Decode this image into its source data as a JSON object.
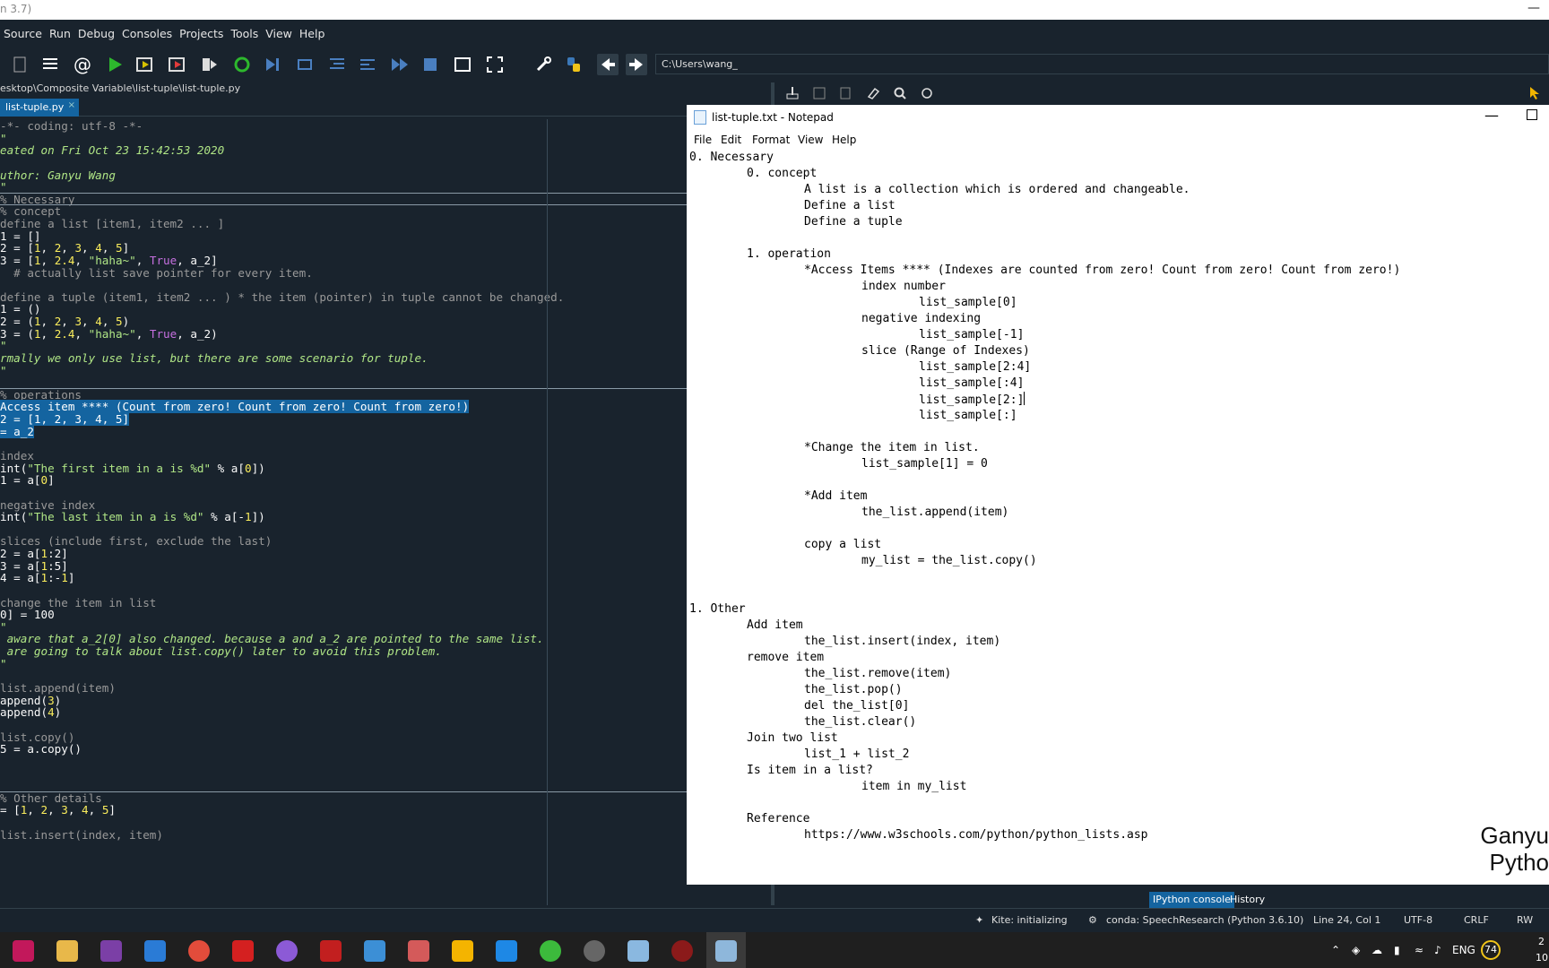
{
  "window": {
    "title_fragment": "n 3.7)"
  },
  "menubar": [
    "Source",
    "Run",
    "Debug",
    "Consoles",
    "Projects",
    "Tools",
    "View",
    "Help"
  ],
  "toolbar": {
    "path": "C:\\Users\\wang_"
  },
  "editor": {
    "file_path": "esktop\\Composite Variable\\list-tuple\\list-tuple.py",
    "tab_label": "list-tuple.py",
    "lines": [
      {
        "t": "-*- coding: utf-8 -*-",
        "c": "com"
      },
      {
        "t": "\"",
        "c": "doc"
      },
      {
        "t": "eated on Fri Oct 23 15:42:53 2020",
        "c": "doc"
      },
      {
        "t": "",
        "c": "doc"
      },
      {
        "t": "uthor: Ganyu Wang",
        "c": "doc"
      },
      {
        "t": "\"",
        "c": "doc"
      },
      {
        "t": "% Necessary",
        "c": "cell"
      },
      {
        "t": "% concept",
        "c": "cell"
      },
      {
        "t": "define a list [item1, item2 ... ]",
        "c": "com"
      },
      {
        "t": "1 = []",
        "c": "code"
      },
      {
        "t": "2 = [1, 2, 3, 4, 5]",
        "c": "code"
      },
      {
        "t": "3 = [1, 2.4, \"haha~\", True, a_2]",
        "c": "code"
      },
      {
        "t": "  # actually list save pointer for every item.",
        "c": "com"
      },
      {
        "t": "",
        "c": "code"
      },
      {
        "t": "define a tuple (item1, item2 ... ) * the item (pointer) in tuple cannot be changed.",
        "c": "com"
      },
      {
        "t": "1 = ()",
        "c": "code"
      },
      {
        "t": "2 = (1, 2, 3, 4, 5)",
        "c": "code"
      },
      {
        "t": "3 = (1, 2.4, \"haha~\", True, a_2)",
        "c": "code"
      },
      {
        "t": "\"",
        "c": "doc"
      },
      {
        "t": "rmally we only use list, but there are some scenario for tuple.",
        "c": "doc"
      },
      {
        "t": "\"",
        "c": "doc"
      },
      {
        "t": "",
        "c": "code"
      },
      {
        "t": "% operations",
        "c": "cell"
      },
      {
        "t": "Access item **** (Count from zero! Count from zero! Count from zero!)",
        "c": "sel"
      },
      {
        "t": "2 = [1, 2, 3, 4, 5]",
        "c": "sel"
      },
      {
        "t": "= a_2",
        "c": "sel"
      },
      {
        "t": "",
        "c": "code"
      },
      {
        "t": "index",
        "c": "com"
      },
      {
        "t": "int(\"The first item in a is %d\" % a[0])",
        "c": "code"
      },
      {
        "t": "1 = a[0]",
        "c": "code"
      },
      {
        "t": "",
        "c": "code"
      },
      {
        "t": "negative index",
        "c": "com"
      },
      {
        "t": "int(\"The last item in a is %d\" % a[-1])",
        "c": "code"
      },
      {
        "t": "",
        "c": "code"
      },
      {
        "t": "slices (include first, exclude the last)",
        "c": "com"
      },
      {
        "t": "2 = a[1:2]",
        "c": "code"
      },
      {
        "t": "3 = a[1:5]",
        "c": "code"
      },
      {
        "t": "4 = a[1:-1]",
        "c": "code"
      },
      {
        "t": "",
        "c": "code"
      },
      {
        "t": "change the item in list",
        "c": "com"
      },
      {
        "t": "0] = 100",
        "c": "code"
      },
      {
        "t": "\"",
        "c": "doc"
      },
      {
        "t": " aware that a_2[0] also changed. because a and a_2 are pointed to the same list.",
        "c": "doc"
      },
      {
        "t": " are going to talk about list.copy() later to avoid this problem.",
        "c": "doc"
      },
      {
        "t": "\"",
        "c": "doc"
      },
      {
        "t": "",
        "c": "code"
      },
      {
        "t": "list.append(item)",
        "c": "com"
      },
      {
        "t": "append(3)",
        "c": "code"
      },
      {
        "t": "append(4)",
        "c": "code"
      },
      {
        "t": "",
        "c": "code"
      },
      {
        "t": "list.copy()",
        "c": "com"
      },
      {
        "t": "5 = a.copy()",
        "c": "code"
      },
      {
        "t": "",
        "c": "code"
      },
      {
        "t": "",
        "c": "code"
      },
      {
        "t": "",
        "c": "code"
      },
      {
        "t": "% Other details",
        "c": "cell"
      },
      {
        "t": "= [1, 2, 3, 4, 5]",
        "c": "code"
      },
      {
        "t": "",
        "c": "code"
      },
      {
        "t": "list.insert(index, item)",
        "c": "com"
      }
    ]
  },
  "notepad": {
    "title": "list-tuple.txt - Notepad",
    "menu": [
      "File",
      "Edit",
      "Format",
      "View",
      "Help"
    ],
    "lines": [
      {
        "i": 0,
        "t": "0. Necessary"
      },
      {
        "i": 1,
        "t": "0. concept"
      },
      {
        "i": 2,
        "t": "A list is a collection which is ordered and changeable."
      },
      {
        "i": 2,
        "t": "Define a list"
      },
      {
        "i": 2,
        "t": "Define a tuple"
      },
      {
        "i": 0,
        "t": ""
      },
      {
        "i": 1,
        "t": "1. operation"
      },
      {
        "i": 2,
        "t": "*Access Items **** (Indexes are counted from zero! Count from zero! Count from zero!)"
      },
      {
        "i": 3,
        "t": "index number"
      },
      {
        "i": 4,
        "t": "list_sample[0]"
      },
      {
        "i": 3,
        "t": "negative indexing"
      },
      {
        "i": 4,
        "t": "list_sample[-1]"
      },
      {
        "i": 3,
        "t": "slice (Range of Indexes)"
      },
      {
        "i": 4,
        "t": "list_sample[2:4]"
      },
      {
        "i": 4,
        "t": "list_sample[:4]"
      },
      {
        "i": 4,
        "t": "list_sample[2:]",
        "caret": true
      },
      {
        "i": 4,
        "t": "list_sample[:]"
      },
      {
        "i": 0,
        "t": ""
      },
      {
        "i": 2,
        "t": "*Change the item in list."
      },
      {
        "i": 3,
        "t": "list_sample[1] = 0"
      },
      {
        "i": 0,
        "t": ""
      },
      {
        "i": 2,
        "t": "*Add item"
      },
      {
        "i": 3,
        "t": "the_list.append(item)"
      },
      {
        "i": 0,
        "t": ""
      },
      {
        "i": 2,
        "t": "copy a list"
      },
      {
        "i": 3,
        "t": "my_list = the_list.copy()"
      },
      {
        "i": 0,
        "t": ""
      },
      {
        "i": 0,
        "t": ""
      },
      {
        "i": 0,
        "t": "1. Other"
      },
      {
        "i": 1,
        "t": "Add item"
      },
      {
        "i": 2,
        "t": "the_list.insert(index, item)"
      },
      {
        "i": 1,
        "t": "remove item"
      },
      {
        "i": 2,
        "t": "the_list.remove(item)"
      },
      {
        "i": 2,
        "t": "the_list.pop()"
      },
      {
        "i": 2,
        "t": "del the_list[0]"
      },
      {
        "i": 2,
        "t": "the_list.clear()"
      },
      {
        "i": 1,
        "t": "Join two list"
      },
      {
        "i": 2,
        "t": "list_1 + list_2"
      },
      {
        "i": 1,
        "t": "Is item in a list?"
      },
      {
        "i": 3,
        "t": "item in my_list"
      },
      {
        "i": 0,
        "t": ""
      },
      {
        "i": 1,
        "t": "Reference"
      },
      {
        "i": 2,
        "t": "https://www.w3schools.com/python/python_lists.asp"
      }
    ],
    "watermark_line1": "Ganyu",
    "watermark_line2": "Pytho"
  },
  "bottom_tabs": [
    "IPython console",
    "History"
  ],
  "status": {
    "kite": "Kite: initializing",
    "conda": "conda: SpeechResearch (Python 3.6.10)",
    "position": "Line 24, Col 1",
    "encoding": "UTF-8",
    "eol": "CRLF",
    "perm": "RW"
  },
  "taskbar": {
    "lang": "ENG",
    "battery": "74",
    "clock_top": "2",
    "clock_bottom": "10"
  },
  "colors": {
    "spyder_bg": "#19232d",
    "selection": "#1464a0",
    "string": "#b0e686",
    "number": "#faed5c",
    "keyword": "#c670e0",
    "comment": "#999999"
  }
}
